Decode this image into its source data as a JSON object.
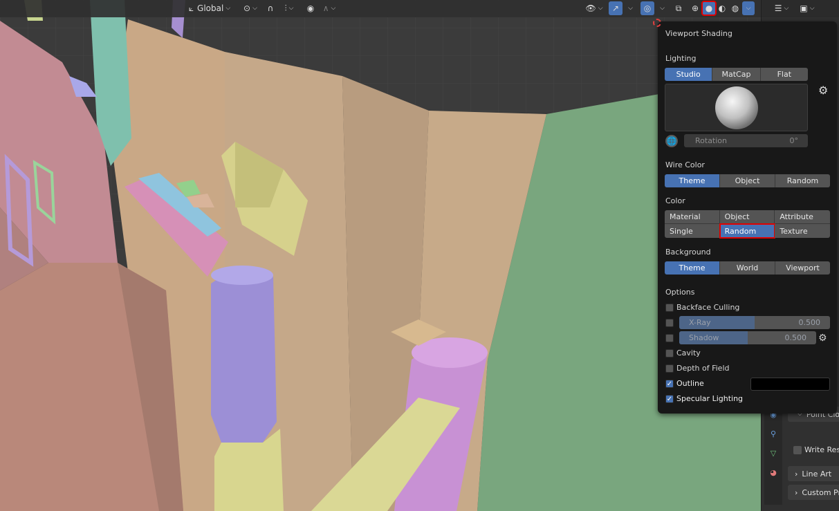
{
  "header": {
    "transform_orientation": "Global",
    "shading_dropdown_chevron": "chevron-down-icon"
  },
  "viewport_shading": {
    "title": "Viewport Shading",
    "lighting": {
      "label": "Lighting",
      "options": [
        "Studio",
        "MatCap",
        "Flat"
      ],
      "selected": "Studio",
      "rotation_label": "Rotation",
      "rotation_value": "0°"
    },
    "wire_color": {
      "label": "Wire Color",
      "options": [
        "Theme",
        "Object",
        "Random"
      ],
      "selected": "Theme"
    },
    "color": {
      "label": "Color",
      "options": [
        "Material",
        "Object",
        "Attribute",
        "Single",
        "Random",
        "Texture"
      ],
      "selected": "Random"
    },
    "background": {
      "label": "Background",
      "options": [
        "Theme",
        "World",
        "Viewport"
      ],
      "selected": "Theme"
    },
    "options": {
      "label": "Options",
      "backface_culling": {
        "label": "Backface Culling",
        "checked": false
      },
      "xray": {
        "label": "X-Ray",
        "checked": false,
        "value": "0.500",
        "fraction": 0.5
      },
      "shadow": {
        "label": "Shadow",
        "checked": false,
        "value": "0.500",
        "fraction": 0.5
      },
      "cavity": {
        "label": "Cavity",
        "checked": false
      },
      "depth_of_field": {
        "label": "Depth of Field",
        "checked": false
      },
      "outline": {
        "label": "Outline",
        "checked": true,
        "color": "#000000"
      },
      "specular_lighting": {
        "label": "Specular Lighting",
        "checked": true
      }
    }
  },
  "properties": {
    "point_cloud": "Point Clo",
    "write_result": "Write Resu",
    "line_art": "Line Art",
    "custom_properties": "Custom Prop"
  },
  "colors": {
    "accent": "#4772b3",
    "highlight": "#e00000",
    "popover_bg": "#181818"
  }
}
